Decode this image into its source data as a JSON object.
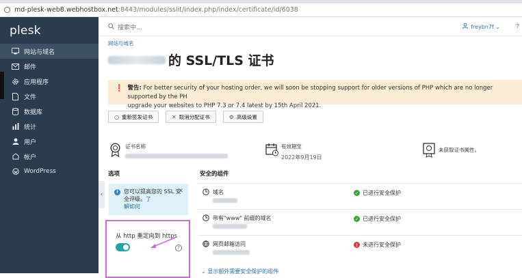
{
  "browser": {
    "url_main": "md-plesk-web8.webhostbox.net",
    "url_rest": ":8443/modules/sslit/index.php/index/certificate/id/6038"
  },
  "sidebar": {
    "logo": "plesk",
    "items": [
      {
        "label": "网站与域名",
        "icon": "monitor-icon",
        "active": true
      },
      {
        "label": "邮件",
        "icon": "mail-icon"
      },
      {
        "label": "应用程序",
        "icon": "gear-icon"
      },
      {
        "label": "文件",
        "icon": "file-icon"
      },
      {
        "label": "数据库",
        "icon": "database-icon"
      },
      {
        "label": "统计",
        "icon": "bar-chart-icon"
      },
      {
        "label": "用户",
        "icon": "user-icon"
      },
      {
        "label": "帐户",
        "icon": "account-icon"
      },
      {
        "label": "WordPress",
        "icon": "wordpress-icon"
      }
    ]
  },
  "topbar": {
    "search_placeholder": "搜索中...",
    "username": "freybn7f",
    "help": "?"
  },
  "breadcrumb": "网站与域名",
  "page_title": "的 SSL/TLS 证书",
  "warning": {
    "label": "警告:",
    "line1": " For better security of your hosting order, we will soon be stopping support for older versions of PHP which are no longer supported by the PH",
    "line2": "upgrade your websites to PHP 7.3 or 7.4 latest by 15th April 2021."
  },
  "buttons": {
    "reissue": "重新签发证书",
    "unassign": "取消分配证书",
    "advanced": "高级设置"
  },
  "cert": {
    "name_label": "证书名称",
    "expiry_label": "有效期至",
    "expiry_value": "2022年9月19日",
    "properties_missing": "未获取证书属性。"
  },
  "options": {
    "heading": "选项",
    "tip_text": "您可以提高您的 SSL 安全评级。",
    "tip_link_1": "了",
    "tip_link_2": "解如何",
    "redirect_label": "从 http 重定向到 https",
    "redirect_on": true
  },
  "components": {
    "heading": "安全的组件",
    "items": [
      {
        "name": "域名",
        "status": "已进行安全保护",
        "secure": true,
        "icon": "globe-icon"
      },
      {
        "name": "带有\"www\" 前缀的域名",
        "status": "已进行安全保护",
        "secure": true,
        "icon": "globe-icon"
      },
      {
        "name": "网页邮箱访问",
        "status": "未进行安全保护",
        "secure": false,
        "icon": "mail-globe-icon"
      }
    ],
    "more": "显示额外需要安全保护的组件"
  },
  "colors": {
    "sidebar_bg": "#2b3c4e",
    "accent": "#2d6fa8",
    "warning_bg": "#fbecd6",
    "toggle_on": "#28a4a6",
    "highlight_border": "#c86cd6"
  }
}
